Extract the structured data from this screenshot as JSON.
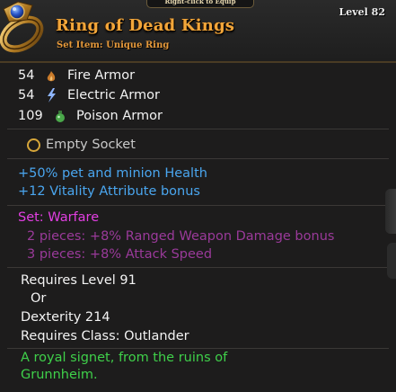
{
  "header": {
    "tab_text": "Right-click to Equip",
    "name": "Ring of Dead Kings",
    "type": "Set Item: Unique Ring",
    "level": "Level 82"
  },
  "armor": [
    {
      "value": "54",
      "icon": "fire-icon",
      "label": "Fire Armor",
      "color": "#d2893a"
    },
    {
      "value": "54",
      "icon": "lightning-icon",
      "label": "Electric Armor",
      "color": "#8fb6ff"
    },
    {
      "value": "109",
      "icon": "poison-icon",
      "label": "Poison Armor",
      "color": "#4aa84a"
    }
  ],
  "socket": {
    "label": "Empty Socket"
  },
  "stats": [
    "+50% pet and minion Health",
    "+12 Vitality Attribute bonus"
  ],
  "set": {
    "title": "Set: Warfare",
    "bonuses": [
      "2 pieces: +8% Ranged Weapon Damage bonus",
      "3 pieces: +8% Attack Speed"
    ]
  },
  "requirements": {
    "level": "Requires Level 91",
    "or": "Or",
    "dexterity": "Dexterity 214",
    "class": "Requires Class: Outlander"
  },
  "flavor": {
    "line1": "A royal signet, from the ruins of",
    "line2": "Grunnheim."
  },
  "colors": {
    "name": "#f2a63a",
    "stat_blue": "#4aa6ef",
    "set_title": "#e23fe2",
    "set_bonus": "#9a3a9a",
    "flavor": "#3fd04a"
  }
}
